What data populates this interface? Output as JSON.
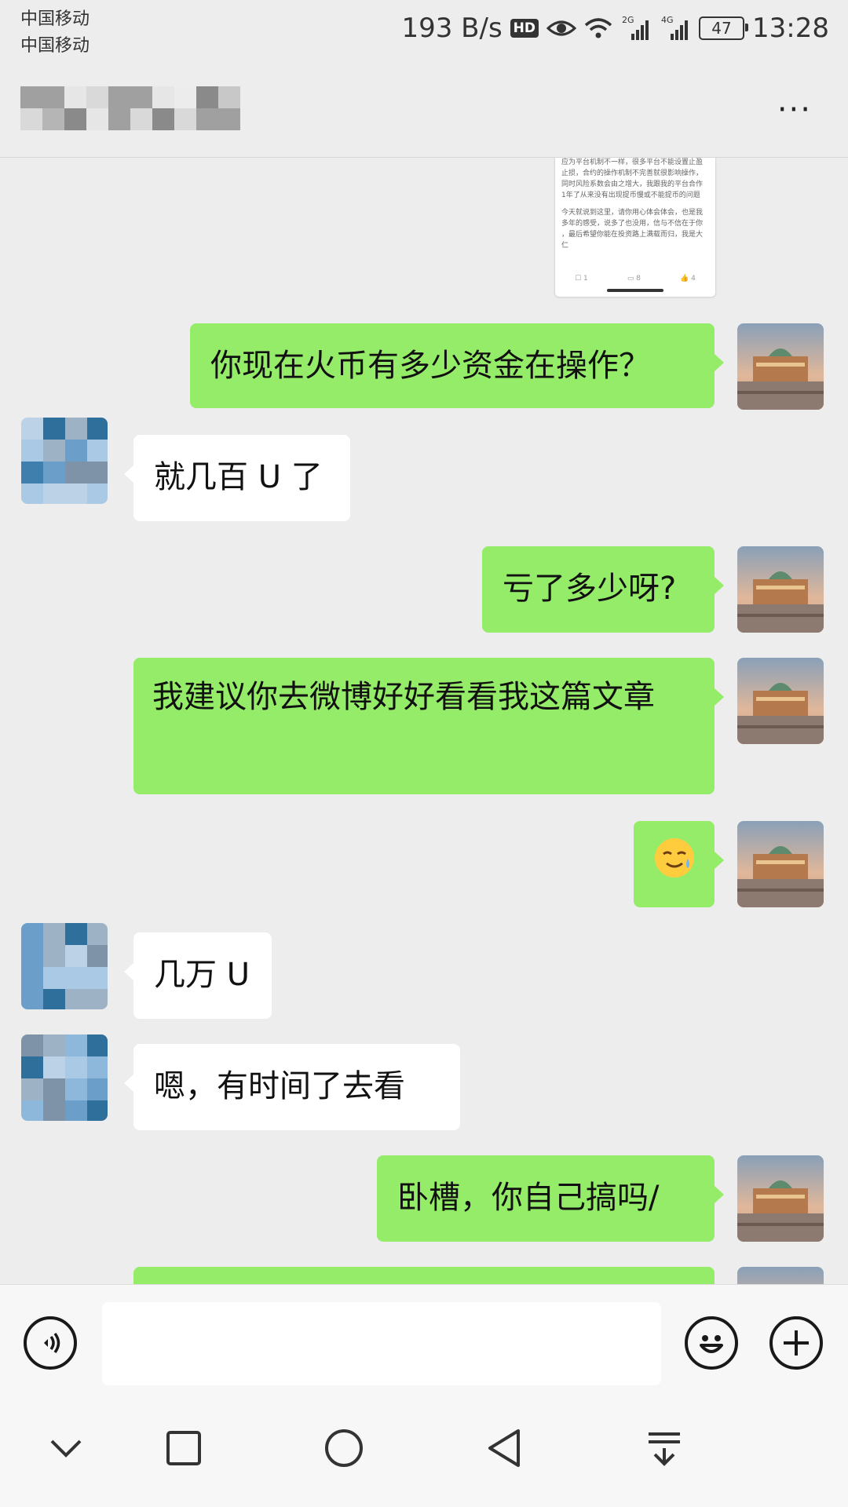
{
  "status_bar": {
    "carrier_1": "中国移动",
    "carrier_2": "中国移动",
    "net_speed": "193 B/s",
    "hd_badge": "HD",
    "net_2g": "2G",
    "net_4g": "4G",
    "battery": "47",
    "time": "13:28"
  },
  "header": {
    "more_label": "···"
  },
  "screenshot_message": {
    "text_lines": [
      "应为平台机制不一样，很多平台不能设置止盈",
      "止损，合约的操作机制不完善就很影响操作，",
      "同时风险系数会由之增大，我跟我的平台合作",
      "1年了从来没有出现提币慢或不能提币的问题",
      "今天就说到这里，请你用心体会体会，也是我",
      "多年的感受，说多了也没用，信与不信在于你",
      "，最后希望你能在投资路上满载而归，我是大",
      "仁"
    ],
    "footer": [
      "☐ 1",
      "▭ 8",
      "👍 4"
    ]
  },
  "messages": [
    {
      "from": "me",
      "text": "你现在火币有多少资金在操作？"
    },
    {
      "from": "them",
      "text": "就几百 U 了"
    },
    {
      "from": "me",
      "text": "亏了多少呀?"
    },
    {
      "from": "me",
      "text": "我建议你去微博好好看看我这篇文章"
    },
    {
      "from": "me",
      "text": "",
      "emoji": "sweat-smile-emoji"
    },
    {
      "from": "them",
      "text": "几万 U"
    },
    {
      "from": "them",
      "text": "嗯，有时间了去看"
    },
    {
      "from": "me",
      "text": "卧槽，你自己搞吗/"
    },
    {
      "from": "me",
      "text": ""
    }
  ],
  "input_bar": {
    "voice_icon": "voice-icon",
    "emoji_icon": "smile-icon",
    "plus_icon": "plus-icon",
    "message_value": ""
  },
  "nav_bar": {
    "icons": [
      "chevron-down-icon",
      "square-icon",
      "circle-icon",
      "back-triangle-icon",
      "notification-pulldown-icon"
    ]
  },
  "colors": {
    "background": "#ededed",
    "my_bubble": "#95ec69",
    "their_bubble": "#ffffff",
    "text": "#111111"
  }
}
